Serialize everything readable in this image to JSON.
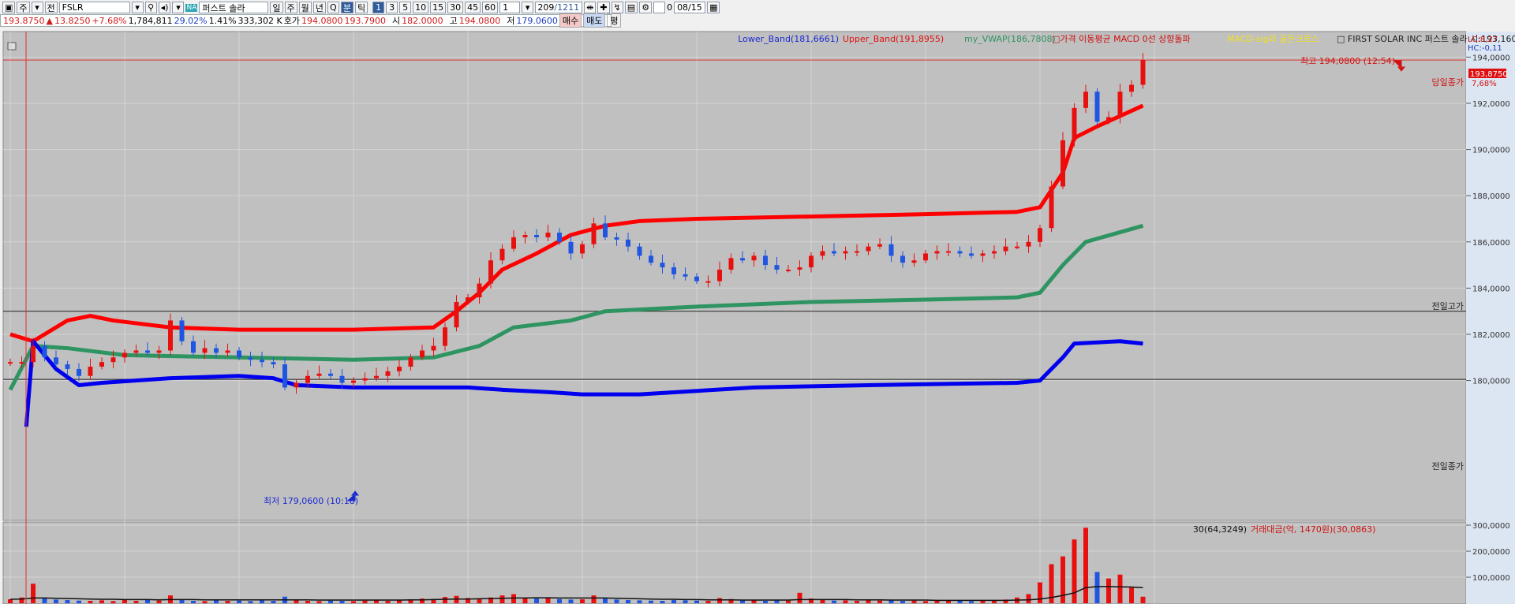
{
  "toolbar": {
    "mode": "주",
    "prev": "전",
    "symbol": "FSLR",
    "na_badge": "NA",
    "name": "퍼스트 솔라",
    "periods": [
      "일",
      "주",
      "월",
      "년",
      "Q",
      "분",
      "틱"
    ],
    "active_period": "분",
    "intervals": [
      "1",
      "3",
      "5",
      "10",
      "15",
      "30",
      "45",
      "60"
    ],
    "active_interval": "1",
    "interval_input": "1",
    "count": "209",
    "total": "/1211",
    "check_label": "0",
    "date": "08/15"
  },
  "quote": {
    "price": "193.8750",
    "arrow": "▲",
    "change": "13.8250",
    "pct": "+7.68%",
    "volume": "1,784,811",
    "ratio1": "29.02%",
    "ratio2": "1.41%",
    "amount": "333,302 K",
    "bid_label": "호가",
    "ask": "194.0800",
    "bid": "193.7900",
    "open_label": "시",
    "open": "182.0000",
    "high_label": "고",
    "high": "194.0800",
    "low_label": "저",
    "low": "179.0600",
    "buy": "매수",
    "sell": "매도",
    "avg": "평"
  },
  "legend": {
    "lower": "Lower_Band(181,6661)",
    "upper": "Upper_Band(191,8955)",
    "vwap": "my_VWAP(186,7808)",
    "macd": "□가격 이동평균 MACD 0선 상향돌파",
    "cross": "MACD-sig와 골든크로스",
    "info": "□ FIRST SOLAR INC  퍼스트 솔라 시:193,1600 고:194,0800 저:193,1600 종:193,8750",
    "lc": "LC:8,27",
    "hc": "HC:-0,11"
  },
  "annotations": {
    "high": "최고 194,0800 (12:54)",
    "low": "최저 179,0600 (10:18)",
    "today_close": "당일종가",
    "prev_high": "전일고가",
    "prev_close": "전일종가",
    "last_price": "193,8750",
    "last_pct": "7,68%"
  },
  "volume_legend": {
    "ma": "30(64,3249)",
    "amount": "거래대금(억, 1470원)(30,0863)"
  },
  "colors": {
    "up": "#e8100f",
    "down": "#1f55e0",
    "upper": "#ff0000",
    "lower": "#0000ee",
    "vwap": "#2e9461"
  },
  "chart_data": [
    {
      "type": "candlestick",
      "title": "FSLR 1분",
      "ylim": [
        179,
        194.5
      ],
      "y_ticks": [
        "194,0000",
        "192,0000",
        "190,0000",
        "188,0000",
        "186,0000",
        "184,0000",
        "182,0000",
        "180,0000"
      ],
      "y_tick_values": [
        194,
        192,
        190,
        188,
        186,
        184,
        182,
        180
      ],
      "prev_high": 183.0,
      "prev_close": 180.05,
      "last": 193.875,
      "closes": [
        180.8,
        180.8,
        181.5,
        181.0,
        180.7,
        180.5,
        180.2,
        180.6,
        180.8,
        181.0,
        181.2,
        181.3,
        181.2,
        181.3,
        182.6,
        181.7,
        181.2,
        181.4,
        181.2,
        181.3,
        181.0,
        180.9,
        180.8,
        180.7,
        179.7,
        179.9,
        180.2,
        180.3,
        180.2,
        179.9,
        180.0,
        180.1,
        180.2,
        180.4,
        180.6,
        181.0,
        181.3,
        181.5,
        182.3,
        183.4,
        183.6,
        184.2,
        185.2,
        185.7,
        186.2,
        186.3,
        186.2,
        186.4,
        186.0,
        185.5,
        185.9,
        186.8,
        186.2,
        186.1,
        185.8,
        185.4,
        185.1,
        184.9,
        184.6,
        184.5,
        184.3,
        184.3,
        184.8,
        185.3,
        185.2,
        185.4,
        185.0,
        184.8,
        184.8,
        184.9,
        185.4,
        185.6,
        185.5,
        185.6,
        185.6,
        185.8,
        185.9,
        185.4,
        185.1,
        185.2,
        185.5,
        185.6,
        185.6,
        185.5,
        185.4,
        185.5,
        185.6,
        185.8,
        185.8,
        186.0,
        186.6,
        188.4,
        190.4,
        191.8,
        192.5,
        191.2,
        191.4,
        192.5,
        192.8,
        193.875
      ],
      "upper_band": [
        [
          0,
          182.0
        ],
        [
          2,
          181.7
        ],
        [
          5,
          182.6
        ],
        [
          7,
          182.8
        ],
        [
          9,
          182.6
        ],
        [
          14,
          182.3
        ],
        [
          20,
          182.2
        ],
        [
          30,
          182.2
        ],
        [
          37,
          182.3
        ],
        [
          39,
          183.0
        ],
        [
          41,
          183.8
        ],
        [
          43,
          184.8
        ],
        [
          46,
          185.5
        ],
        [
          49,
          186.3
        ],
        [
          52,
          186.7
        ],
        [
          55,
          186.9
        ],
        [
          60,
          187.0
        ],
        [
          70,
          187.1
        ],
        [
          80,
          187.2
        ],
        [
          88,
          187.3
        ],
        [
          90,
          187.5
        ],
        [
          92,
          189.0
        ],
        [
          93,
          190.5
        ],
        [
          95,
          191.0
        ],
        [
          99,
          191.9
        ]
      ],
      "lower_band": [
        [
          1.4,
          178.0
        ],
        [
          2,
          181.7
        ],
        [
          4,
          180.5
        ],
        [
          6,
          179.8
        ],
        [
          8,
          179.9
        ],
        [
          14,
          180.1
        ],
        [
          20,
          180.2
        ],
        [
          23,
          180.1
        ],
        [
          25,
          179.8
        ],
        [
          30,
          179.7
        ],
        [
          40,
          179.7
        ],
        [
          43,
          179.6
        ],
        [
          47,
          179.5
        ],
        [
          50,
          179.4
        ],
        [
          55,
          179.4
        ],
        [
          65,
          179.7
        ],
        [
          75,
          179.8
        ],
        [
          88,
          179.9
        ],
        [
          90,
          180.0
        ],
        [
          92,
          181.0
        ],
        [
          93,
          181.6
        ],
        [
          97,
          181.7
        ],
        [
          99,
          181.6
        ]
      ],
      "vwap": [
        [
          0,
          179.6
        ],
        [
          2,
          181.5
        ],
        [
          5,
          181.4
        ],
        [
          10,
          181.1
        ],
        [
          20,
          181.0
        ],
        [
          30,
          180.9
        ],
        [
          37,
          181.0
        ],
        [
          41,
          181.5
        ],
        [
          44,
          182.3
        ],
        [
          49,
          182.6
        ],
        [
          52,
          183.0
        ],
        [
          60,
          183.2
        ],
        [
          70,
          183.4
        ],
        [
          80,
          183.5
        ],
        [
          88,
          183.6
        ],
        [
          90,
          183.8
        ],
        [
          92,
          185.0
        ],
        [
          94,
          186.0
        ],
        [
          99,
          186.7
        ]
      ]
    },
    {
      "type": "bar",
      "title": "Volume",
      "y_ticks": [
        "300,0000",
        "200,0000",
        "100,0000"
      ],
      "y_tick_values": [
        300000,
        200000,
        100000
      ],
      "values": [
        15000,
        22000,
        75000,
        20000,
        14000,
        12000,
        10000,
        9000,
        11000,
        8000,
        12000,
        9000,
        14000,
        10000,
        30000,
        12000,
        9000,
        8000,
        11000,
        9000,
        10000,
        8000,
        12000,
        9000,
        25000,
        12000,
        9000,
        8000,
        10000,
        9000,
        8000,
        10000,
        12000,
        9000,
        11000,
        14000,
        18000,
        16000,
        24000,
        28000,
        20000,
        18000,
        22000,
        30000,
        35000,
        20000,
        18000,
        22000,
        16000,
        14000,
        15000,
        30000,
        18000,
        14000,
        12000,
        11000,
        10000,
        9000,
        12000,
        11000,
        10000,
        9000,
        20000,
        16000,
        12000,
        11000,
        9000,
        12000,
        10000,
        40000,
        18000,
        12000,
        10000,
        11000,
        9000,
        12000,
        10000,
        11000,
        9000,
        10000,
        8000,
        9000,
        10000,
        9000,
        8000,
        10000,
        12000,
        14000,
        22000,
        35000,
        80000,
        150000,
        180000,
        245000,
        290000,
        120000,
        95000,
        110000,
        60000,
        25000
      ],
      "ma": [
        15000,
        16000,
        20000,
        20000,
        19000,
        18000,
        17000,
        16000,
        15000,
        15000,
        14000,
        14000,
        14000,
        13000,
        14000,
        14000,
        14000,
        13000,
        13000,
        13000,
        13000,
        13000,
        13000,
        13000,
        13000,
        13000,
        13000,
        12000,
        12000,
        12000,
        12000,
        12000,
        12000,
        12000,
        12000,
        13000,
        13000,
        14000,
        15000,
        16000,
        16000,
        17000,
        18000,
        19000,
        20000,
        20000,
        21000,
        21000,
        20000,
        20000,
        20000,
        20000,
        20000,
        19000,
        18000,
        17000,
        16000,
        15000,
        15000,
        14000,
        14000,
        13000,
        13000,
        13000,
        12000,
        12000,
        12000,
        12000,
        12000,
        14000,
        14000,
        14000,
        14000,
        14000,
        13000,
        13000,
        13000,
        12000,
        12000,
        12000,
        12000,
        11000,
        11000,
        11000,
        11000,
        11000,
        11000,
        11000,
        12000,
        13000,
        16000,
        22000,
        30000,
        40000,
        60000,
        64000,
        64000,
        63000,
        62000,
        60000
      ]
    }
  ]
}
